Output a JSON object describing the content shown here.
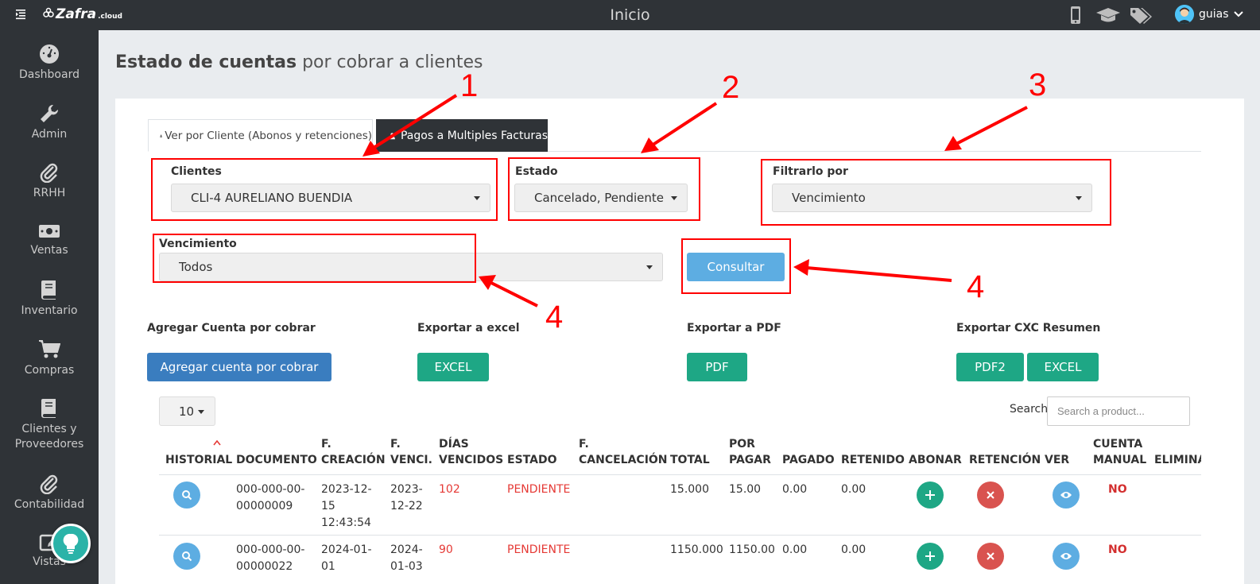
{
  "topbar": {
    "brand": "Zafra",
    "brand_suffix": ".cloud",
    "title": "Inicio",
    "user": "guias"
  },
  "sidebar": {
    "items": [
      {
        "label": "Dashboard",
        "icon": "dashboard-icon"
      },
      {
        "label": "Admin",
        "icon": "wrench-icon"
      },
      {
        "label": "RRHH",
        "icon": "paperclip-icon"
      },
      {
        "label": "Ventas",
        "icon": "money-icon"
      },
      {
        "label": "Inventario",
        "icon": "book-icon"
      },
      {
        "label": "Compras",
        "icon": "cart-icon"
      },
      {
        "label": "Clientes y",
        "label2": "Proveedores",
        "icon": "book-icon"
      },
      {
        "label": "Contabilidad",
        "icon": "paperclip-icon"
      },
      {
        "label": "Vistas",
        "icon": "edit-icon"
      }
    ]
  },
  "heading": {
    "bold": "Estado de cuentas",
    "light": "por cobrar a clientes"
  },
  "tabs": {
    "by_client": "Ver por Cliente (Abonos y retenciones)",
    "multi_pay": "Pagos a Multiples Facturas"
  },
  "filters": {
    "clientes_label": "Clientes",
    "clientes_value": "CLI-4 AURELIANO BUENDIA",
    "estado_label": "Estado",
    "estado_value": "Cancelado, Pendiente",
    "filtrar_label": "Filtrarlo por",
    "filtrar_value": "Vencimiento",
    "vencimiento_label": "Vencimiento",
    "vencimiento_value": "Todos",
    "consultar": "Consultar"
  },
  "actions": {
    "agregar_label": "Agregar Cuenta por cobrar",
    "agregar_btn": "Agregar cuenta por cobrar",
    "excel_label": "Exportar a excel",
    "excel_btn": "EXCEL",
    "pdf_label": "Exportar a PDF",
    "pdf_btn": "PDF",
    "resumen_label": "Exportar CXC Resumen",
    "pdf2_btn": "PDF2",
    "excel2_btn": "EXCEL"
  },
  "table": {
    "page_size": "10",
    "search_label": "Search:",
    "search_placeholder": "Search a product...",
    "headers": {
      "historial": "HISTORIAL",
      "documento": "DOCUMENTO",
      "f_creacion_1": "F.",
      "f_creacion_2": "CREACIÓN",
      "f_venci_1": "F.",
      "f_venci_2": "VENCI.",
      "dias_1": "DÍAS",
      "dias_2": "VENCIDOS",
      "estado": "ESTADO",
      "f_cancel_1": "F.",
      "f_cancel_2": "CANCELACIÓN",
      "total": "TOTAL",
      "por_pagar_1": "POR",
      "por_pagar_2": "PAGAR",
      "pagado": "PAGADO",
      "retenido": "RETENIDO",
      "abonar": "ABONAR",
      "retencion": "RETENCIÓN",
      "ver": "VER",
      "cuenta_1": "CUENTA",
      "cuenta_2": "MANUAL",
      "elimina": "ELIMINA"
    },
    "rows": [
      {
        "doc_1": "000-000-00-",
        "doc_2": "00000009",
        "creacion_1": "2023-12-",
        "creacion_2": "15",
        "creacion_3": "12:43:54",
        "venci_1": "2023-",
        "venci_2": "12-22",
        "dias": "102",
        "estado": "PENDIENTE",
        "total": "15.000",
        "por_pagar": "15.00",
        "pagado": "0.00",
        "retenido": "0.00",
        "manual": "NO"
      },
      {
        "doc_1": "000-000-00-",
        "doc_2": "00000022",
        "creacion_1": "2024-01-",
        "creacion_2": "01",
        "creacion_3": "",
        "venci_1": "2024-",
        "venci_2": "01-03",
        "dias": "90",
        "estado": "PENDIENTE",
        "total": "1150.000",
        "por_pagar": "1150.00",
        "pagado": "0.00",
        "retenido": "0.00",
        "manual": "NO"
      }
    ]
  },
  "annotations": {
    "n1": "1",
    "n2": "2",
    "n3": "3",
    "n4a": "4",
    "n4b": "4",
    "color": "#ff0000"
  },
  "colors": {
    "sidebar": "#2f3337",
    "accent_blue": "#5dade2",
    "navy_button": "#3a7dbf",
    "green_button": "#1ea785",
    "danger": "#d9534f",
    "status_red": "#e53935"
  }
}
